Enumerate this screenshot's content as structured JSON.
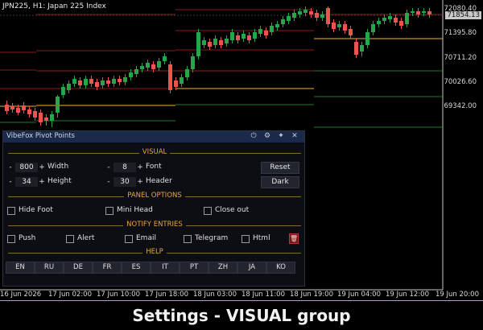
{
  "chart": {
    "symbol_title": "JPN225, H1:  Japan 225 Index",
    "price_axis": [
      "72080.40",
      "71395.80",
      "70711.20",
      "70026.60",
      "69342.00"
    ],
    "current_price": "71854.13",
    "time_axis": [
      "16 Jun 2026",
      "17 Jun 02:00",
      "17 Jun 10:00",
      "17 Jun 18:00",
      "18 Jun 03:00",
      "18 Jun 11:00",
      "18 Jun 19:00",
      "19 Jun 04:00",
      "19 Jun 12:00",
      "19 Jun 20:00"
    ],
    "colors": {
      "bull": "#26a64a",
      "bear": "#ef5350",
      "pivot": "#f0b429",
      "resistance": "#8b1a1a",
      "support": "#1f7a2e"
    }
  },
  "panel": {
    "title": "VibeFox Pivot Points",
    "icons": [
      "power-icon",
      "gear-icon",
      "pin-icon",
      "close-icon"
    ],
    "icon_glyphs": [
      "⏻",
      "⚙",
      "✦",
      "✕"
    ],
    "visual": {
      "heading": "VISUAL",
      "width_label": "Width",
      "width_value": "800",
      "height_label": "Height",
      "height_value": "34",
      "font_label": "Font",
      "font_value": "8",
      "header_label": "Header",
      "header_value": "30",
      "minus": "-",
      "plus": "+",
      "reset_label": "Reset",
      "dark_label": "Dark"
    },
    "panel_options": {
      "heading": "PANEL OPTIONS",
      "hide_foot": "Hide Foot",
      "mini_head": "Mini Head",
      "close_out": "Close out"
    },
    "notify": {
      "heading": "NOTIFY ENTRIES",
      "push": "Push",
      "alert": "Alert",
      "email": "Email",
      "telegram": "Telegram",
      "html": "Html"
    },
    "help": {
      "heading": "HELP",
      "languages": [
        "EN",
        "RU",
        "DE",
        "FR",
        "ES",
        "IT",
        "PT",
        "ZH",
        "JA",
        "KO"
      ]
    }
  },
  "caption": "Settings - VISUAL group"
}
